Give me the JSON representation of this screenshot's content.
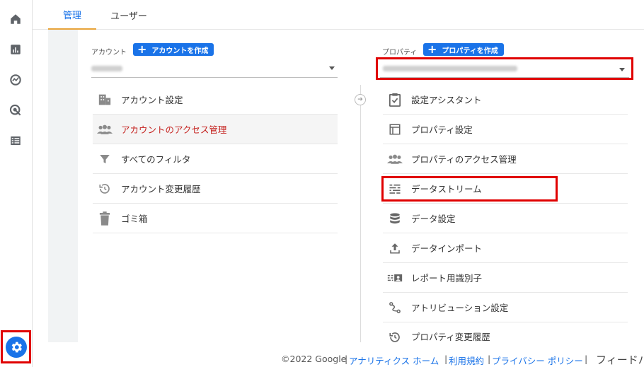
{
  "rail": {
    "icons": [
      "home-icon",
      "reports-icon",
      "explore-icon",
      "advertising-icon",
      "configure-icon"
    ],
    "settings_icon": "gear-icon"
  },
  "tabs": {
    "admin": "管理",
    "user": "ユーザー"
  },
  "account": {
    "label": "アカウント",
    "create_button": "アカウントを作成",
    "items": [
      {
        "label": "アカウント設定",
        "icon": "building-icon"
      },
      {
        "label": "アカウントのアクセス管理",
        "icon": "people-icon"
      },
      {
        "label": "すべてのフィルタ",
        "icon": "filter-icon"
      },
      {
        "label": "アカウント変更履歴",
        "icon": "history-icon"
      },
      {
        "label": "ゴミ箱",
        "icon": "trash-icon"
      }
    ]
  },
  "property": {
    "label": "プロパティ",
    "create_button": "プロパティを作成",
    "items": [
      {
        "label": "設定アシスタント",
        "icon": "checklist-icon"
      },
      {
        "label": "プロパティ設定",
        "icon": "layout-icon"
      },
      {
        "label": "プロパティのアクセス管理",
        "icon": "people-icon"
      },
      {
        "label": "データストリーム",
        "icon": "streams-icon"
      },
      {
        "label": "データ設定",
        "icon": "database-icon"
      },
      {
        "label": "データインポート",
        "icon": "upload-icon"
      },
      {
        "label": "レポート用識別子",
        "icon": "identifier-icon"
      },
      {
        "label": "アトリビューション設定",
        "icon": "attribution-icon"
      },
      {
        "label": "プロパティ変更履歴",
        "icon": "history-icon"
      }
    ]
  },
  "footer": {
    "copyright": "©2022 Google",
    "sep": "|",
    "links": [
      "アナリティクス ホーム",
      "利用規約",
      "プライバシー ポリシー"
    ],
    "feedback": "フィードバック"
  }
}
